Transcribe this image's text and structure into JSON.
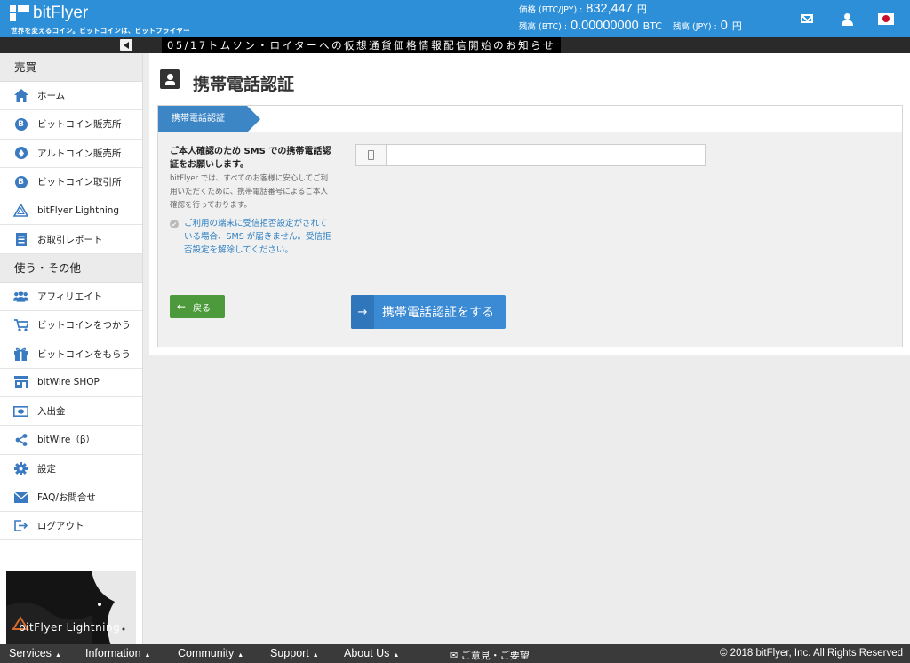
{
  "header": {
    "logo_text": "bitFlyer",
    "tagline": "世界を変えるコイン。ビットコインは、ビットフライヤー",
    "price_label": "価格 (BTC/JPY) :",
    "price_value": "832,447",
    "price_unit": "円",
    "btc_balance_label": "残高 (BTC) :",
    "btc_balance_value": "0.00000000",
    "btc_unit": "BTC",
    "jpy_balance_label": "残高 (JPY) :",
    "jpy_balance_value": "0",
    "jpy_unit": "円"
  },
  "news": {
    "text": "05/17トムソン・ロイターへの仮想通貨価格情報配信開始のお知らせ"
  },
  "sidebar": {
    "section_trade": "売買",
    "section_other": "使う・その他",
    "items_trade": [
      {
        "label": "ホーム",
        "icon": "home-icon"
      },
      {
        "label": "ビットコイン販売所",
        "icon": "bitcoin-icon"
      },
      {
        "label": "アルトコイン販売所",
        "icon": "ethereum-icon"
      },
      {
        "label": "ビットコイン取引所",
        "icon": "bitcoin-icon"
      },
      {
        "label": "bitFlyer Lightning",
        "icon": "lightning-triangle-icon"
      },
      {
        "label": "お取引レポート",
        "icon": "report-icon"
      }
    ],
    "items_other": [
      {
        "label": "アフィリエイト",
        "icon": "users-icon"
      },
      {
        "label": "ビットコインをつかう",
        "icon": "cart-icon"
      },
      {
        "label": "ビットコインをもらう",
        "icon": "gift-icon"
      },
      {
        "label": "bitWire SHOP",
        "icon": "shop-icon"
      },
      {
        "label": "入出金",
        "icon": "money-icon"
      },
      {
        "label": "bitWire（β）",
        "icon": "share-icon"
      },
      {
        "label": "設定",
        "icon": "gear-icon"
      },
      {
        "label": "FAQ/お問合せ",
        "icon": "mail-icon"
      },
      {
        "label": "ログアウト",
        "icon": "logout-icon"
      }
    ],
    "banner_text": "bitFlyer Lightning"
  },
  "main": {
    "title": "携帯電話認証",
    "step_label": "携帯電話認証",
    "desc_strong": "ご本人確認のため SMS での携帯電話認証をお願いします。",
    "desc_small": "bitFlyer では、すべてのお客様に安心してご利用いただくために、携帯電話番号によるご本人確認を行っております。",
    "note": "ご利用の端末に受信拒否設定がされている場合、SMS が届きません。受信拒否設定を解除してください。",
    "phone_value": "",
    "back_label": "戻る",
    "submit_label": "携帯電話認証をする"
  },
  "footer": {
    "links": [
      "Services",
      "Information",
      "Community",
      "Support",
      "About Us"
    ],
    "feedback": "ご意見・ご要望",
    "copyright": "© 2018 bitFlyer, Inc. All Rights Reserved"
  },
  "colors": {
    "brand_blue": "#2d8fd8",
    "button_green": "#4c9a3c",
    "button_blue": "#3b8ad4",
    "note_blue": "#2d7fc1"
  }
}
